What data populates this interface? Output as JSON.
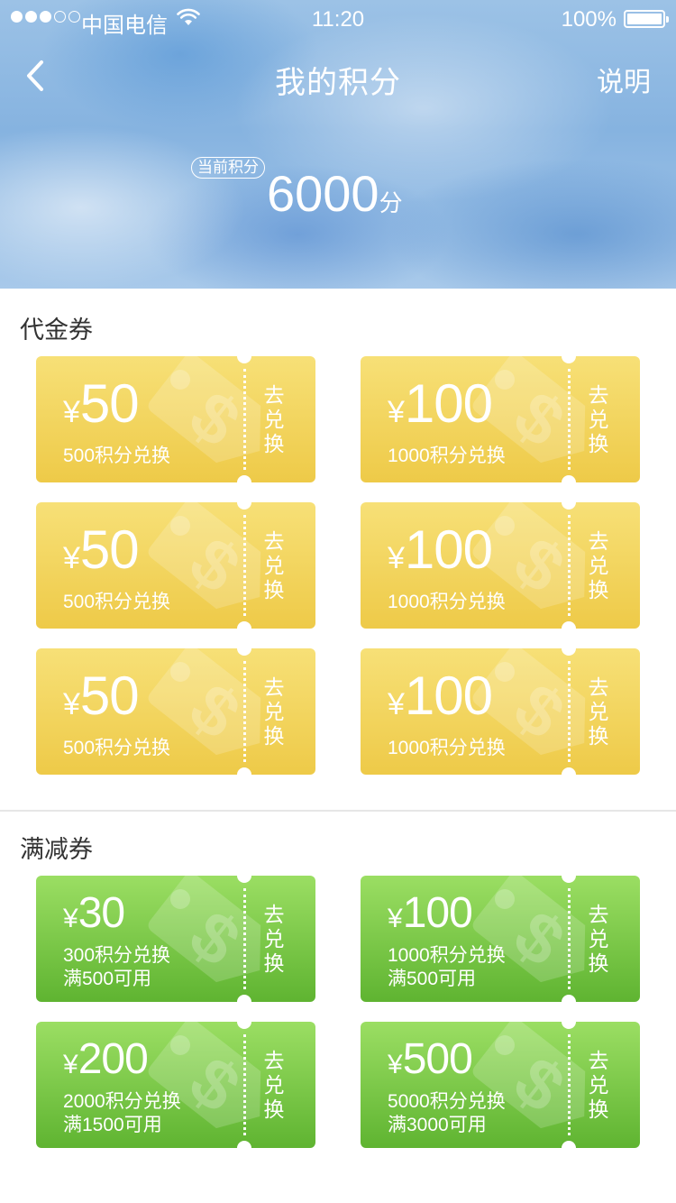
{
  "status_bar": {
    "carrier": "中国电信",
    "time": "11:20",
    "battery": "100%"
  },
  "nav": {
    "title": "我的积分",
    "help": "说明"
  },
  "points": {
    "label": "当前积分",
    "value": "6000",
    "unit": "分"
  },
  "cash_section": {
    "title": "代金券",
    "coupons": [
      {
        "currency": "¥",
        "amount": "50",
        "cost": "500积分兑换",
        "action": "去兑换"
      },
      {
        "currency": "¥",
        "amount": "100",
        "cost": "1000积分兑换",
        "action": "去兑换"
      },
      {
        "currency": "¥",
        "amount": "50",
        "cost": "500积分兑换",
        "action": "去兑换"
      },
      {
        "currency": "¥",
        "amount": "100",
        "cost": "1000积分兑换",
        "action": "去兑换"
      },
      {
        "currency": "¥",
        "amount": "50",
        "cost": "500积分兑换",
        "action": "去兑换"
      },
      {
        "currency": "¥",
        "amount": "100",
        "cost": "1000积分兑换",
        "action": "去兑换"
      }
    ]
  },
  "discount_section": {
    "title": "满减券",
    "coupons": [
      {
        "currency": "¥",
        "amount": "30",
        "cost": "300积分兑换",
        "condition": "满500可用",
        "action": "去兑换"
      },
      {
        "currency": "¥",
        "amount": "100",
        "cost": "1000积分兑换",
        "condition": "满500可用",
        "action": "去兑换"
      },
      {
        "currency": "¥",
        "amount": "200",
        "cost": "2000积分兑换",
        "condition": "满1500可用",
        "action": "去兑换"
      },
      {
        "currency": "¥",
        "amount": "500",
        "cost": "5000积分兑换",
        "condition": "满3000可用",
        "action": "去兑换"
      }
    ]
  },
  "colors": {
    "cash_coupon": "#eeca48",
    "discount_coupon": "#5fb431",
    "header": "#86b3e0"
  },
  "icons": {
    "back": "chevron-left-icon",
    "wifi": "wifi-icon",
    "battery": "battery-icon",
    "coupon_deco": "price-tag-dollar-icon"
  }
}
